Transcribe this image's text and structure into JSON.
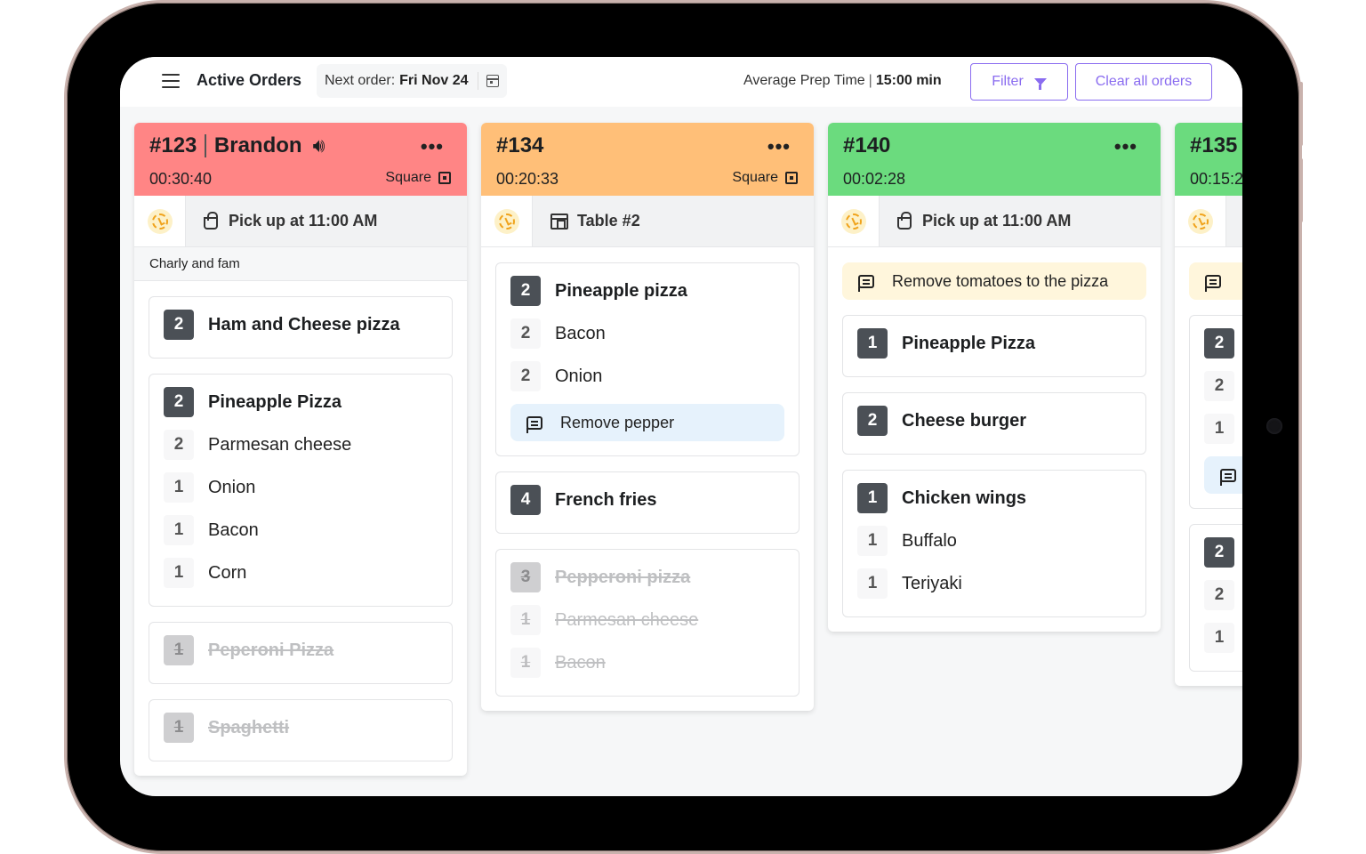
{
  "topbar": {
    "title": "Active Orders",
    "next_order_label": "Next order:",
    "next_order_date": "Fri Nov 24",
    "avg_label": "Average Prep Time",
    "avg_value": "15:00 min",
    "filter_label": "Filter",
    "clear_label": "Clear all orders",
    "accent_color": "#8a6cf0"
  },
  "orders": [
    {
      "number": "#123",
      "customer": "Brandon",
      "timer": "00:30:40",
      "source": "Square",
      "status_color": "#ff8585",
      "fulfillment": "Pick up at 11:00 AM",
      "fulfillment_icon": "shopping-bag-icon",
      "customer_note": "Charly and fam",
      "items": [
        {
          "qty": "2",
          "name": "Ham and Cheese pizza",
          "done": false,
          "mods": []
        },
        {
          "qty": "2",
          "name": "Pineapple Pizza",
          "done": false,
          "mods": [
            {
              "qty": "2",
              "name": "Parmesan cheese"
            },
            {
              "qty": "1",
              "name": "Onion"
            },
            {
              "qty": "1",
              "name": "Bacon"
            },
            {
              "qty": "1",
              "name": "Corn"
            }
          ]
        },
        {
          "qty": "1",
          "name": "Peperoni Pizza",
          "done": true,
          "mods": []
        },
        {
          "qty": "1",
          "name": "Spaghetti",
          "done": true,
          "mods": []
        }
      ]
    },
    {
      "number": "#134",
      "timer": "00:20:33",
      "source": "Square",
      "status_color": "#ffbf78",
      "fulfillment": "Table #2",
      "fulfillment_icon": "store-icon",
      "items": [
        {
          "qty": "2",
          "name": "Pineapple pizza",
          "done": false,
          "mods": [
            {
              "qty": "2",
              "name": "Bacon"
            },
            {
              "qty": "2",
              "name": "Onion"
            }
          ],
          "note": "Remove pepper"
        },
        {
          "qty": "4",
          "name": "French fries",
          "done": false,
          "mods": []
        },
        {
          "qty": "3",
          "name": "Pepperoni pizza",
          "done": true,
          "mods": [
            {
              "qty": "1",
              "name": "Parmesan cheese"
            },
            {
              "qty": "1",
              "name": "Bacon"
            }
          ]
        }
      ]
    },
    {
      "number": "#140",
      "timer": "00:02:28",
      "status_color": "#6bdb7e",
      "fulfillment": "Pick up at 11:00 AM",
      "fulfillment_icon": "shopping-bag-icon",
      "order_note": "Remove tomatoes to the pizza",
      "items": [
        {
          "qty": "1",
          "name": "Pineapple Pizza",
          "done": false,
          "mods": []
        },
        {
          "qty": "2",
          "name": "Cheese burger",
          "done": false,
          "mods": []
        },
        {
          "qty": "1",
          "name": "Chicken wings",
          "done": false,
          "mods": [
            {
              "qty": "1",
              "name": "Buffalo"
            },
            {
              "qty": "1",
              "name": "Teriyaki"
            }
          ]
        }
      ]
    },
    {
      "number": "#135",
      "timer": "00:15:2",
      "status_color": "#6bdb7e",
      "partial": true,
      "items": [
        {
          "qty": "2",
          "mods": [
            {
              "qty": "2"
            },
            {
              "qty": "1"
            }
          ],
          "has_note": true
        },
        {
          "qty": "2",
          "mods": [
            {
              "qty": "2"
            },
            {
              "qty": "1"
            }
          ]
        }
      ]
    }
  ]
}
